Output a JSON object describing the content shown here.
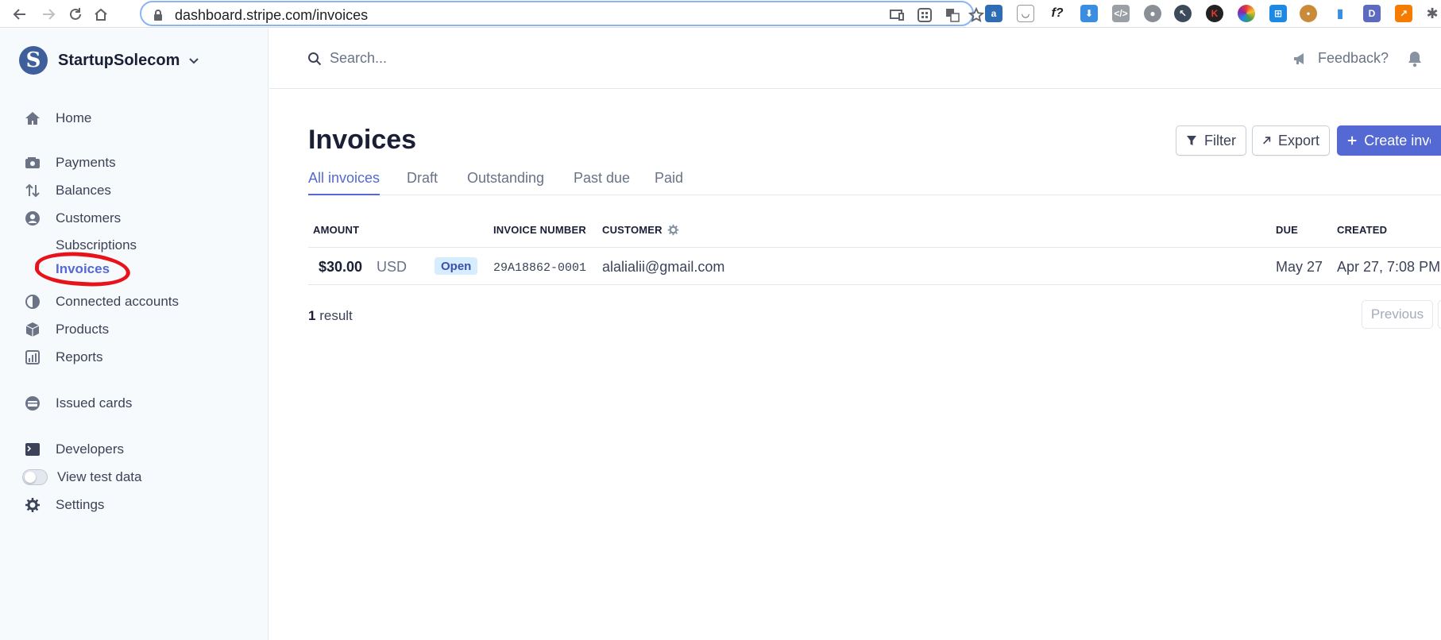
{
  "browser": {
    "url": "dashboard.stripe.com/invoices"
  },
  "brand": {
    "name": "StartupSolecom",
    "logo_letter": "S",
    "logo_color": "#3f5f9c"
  },
  "sidebar": {
    "items": [
      {
        "label": "Home",
        "icon": "home-icon"
      },
      {
        "label": "Payments",
        "icon": "payments-icon"
      },
      {
        "label": "Balances",
        "icon": "balances-icon"
      },
      {
        "label": "Customers",
        "icon": "customers-icon"
      },
      {
        "label": "Connected accounts",
        "icon": "connected-accounts-icon"
      },
      {
        "label": "Products",
        "icon": "products-icon"
      },
      {
        "label": "Reports",
        "icon": "reports-icon"
      },
      {
        "label": "Issued cards",
        "icon": "issued-cards-icon"
      },
      {
        "label": "Developers",
        "icon": "developers-icon"
      },
      {
        "label": "View test data",
        "icon": "toggle"
      },
      {
        "label": "Settings",
        "icon": "gear-icon"
      }
    ],
    "sub_items": [
      {
        "label": "Subscriptions"
      },
      {
        "label": "Invoices",
        "active": true
      }
    ]
  },
  "topbar": {
    "search_placeholder": "Search...",
    "feedback_label": "Feedback?"
  },
  "main": {
    "title": "Invoices",
    "buttons": {
      "filter": "Filter",
      "export": "Export",
      "create": "Create invoi"
    },
    "tabs": [
      "All invoices",
      "Draft",
      "Outstanding",
      "Past due",
      "Paid"
    ],
    "table": {
      "headers": {
        "amount": "AMOUNT",
        "invoice_number": "INVOICE NUMBER",
        "customer": "CUSTOMER",
        "due": "DUE",
        "created": "CREATED"
      },
      "rows": [
        {
          "amount": "$30.00",
          "currency": "USD",
          "status": "Open",
          "invoice_number": "29A18862-0001",
          "customer": "alalialii@gmail.com",
          "due": "May 27",
          "created": "Apr 27, 7:08 PM"
        }
      ]
    },
    "result_count": "1",
    "result_label": "result",
    "pagination": {
      "previous": "Previous"
    }
  },
  "colors": {
    "accent": "#5469d4",
    "annotation": "#e8131a",
    "badge_bg": "#d6ecff"
  }
}
